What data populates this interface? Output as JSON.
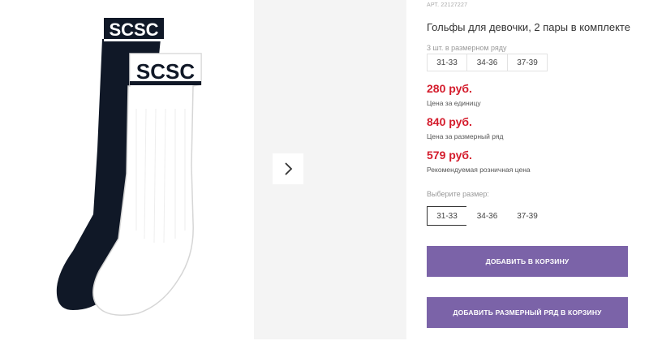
{
  "product": {
    "sku_label": "АРТ. 22127227",
    "title": "Гольфы для девочки, 2 пары в комплекте",
    "brand_text": "SCSC"
  },
  "size_set": {
    "label": "3 шт. в размерном ряду",
    "sizes": [
      "31-33",
      "34-36",
      "37-39"
    ]
  },
  "prices": [
    {
      "value": "280 руб.",
      "note": "Цена за единицу"
    },
    {
      "value": "840 руб.",
      "note": "Цена за размерный ряд"
    },
    {
      "value": "579 руб.",
      "note": "Рекомендуемая розничная цена"
    }
  ],
  "size_picker": {
    "label": "Выберите размер:",
    "options": [
      "31-33",
      "34-36",
      "37-39"
    ],
    "selected": "31-33"
  },
  "actions": {
    "add_to_cart": "ДОБАВИТЬ В КОРЗИНУ",
    "add_size_set": "ДОБАВИТЬ РАЗМЕРНЫЙ РЯД В КОРЗИНУ"
  },
  "colors": {
    "price": "#d41c2c",
    "button": "#7b63a8",
    "gallery_bg": "#f4f4f4"
  },
  "icons": {
    "next": "chevron-right-icon"
  }
}
